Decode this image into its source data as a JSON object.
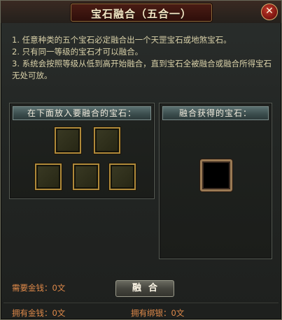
{
  "window": {
    "title": "宝石融合（五合一）",
    "close_glyph": "✕"
  },
  "instructions": [
    "1. 任意种类的五个宝石必定融合出一个天罡宝石或地煞宝石。",
    "2. 只有同一等级的宝石才可以融合。",
    "3. 系统会按照等级从低到高开始融合，直到宝石全被融合或融合所得宝石无处可放。"
  ],
  "input_panel": {
    "header": "在下面放入要融合的宝石："
  },
  "output_panel": {
    "header": "融合获得的宝石："
  },
  "fuse_button": {
    "label": "融合"
  },
  "footer": {
    "required_money_label": "需要金钱：",
    "required_money_value": "0文",
    "owned_money_label": "拥有金钱：",
    "owned_money_value": "0文",
    "owned_bound_silver_label": "拥有绑银：",
    "owned_bound_silver_value": "0文"
  },
  "colors": {
    "accent_gold": "#b08a3a",
    "warning_orange": "#e08a4a",
    "text_main": "#d8d0a8"
  }
}
